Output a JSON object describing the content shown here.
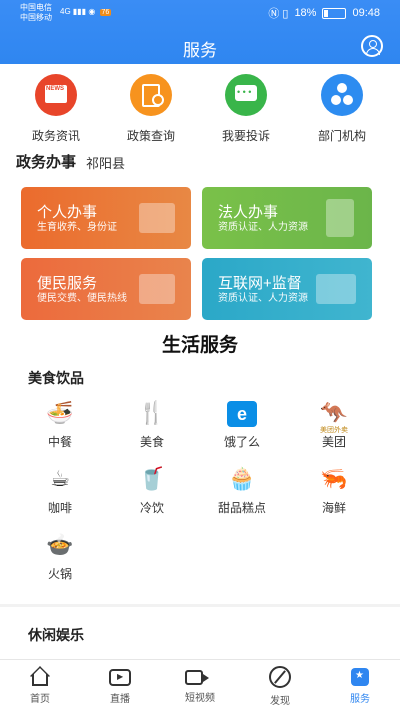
{
  "status_bar": {
    "carrier_1": "中国电信",
    "carrier_2": "中国移动",
    "network": "4G",
    "signal_badge": "76",
    "battery": "18%",
    "time": "09:48"
  },
  "header": {
    "title": "服务"
  },
  "quick_links": [
    {
      "label": "政务资讯",
      "icon": "news-icon",
      "color": "#e8452a"
    },
    {
      "label": "政策查询",
      "icon": "policy-search-icon",
      "color": "#f7931e"
    },
    {
      "label": "我要投诉",
      "icon": "complaint-icon",
      "color": "#39b54a"
    },
    {
      "label": "部门机构",
      "icon": "org-icon",
      "color": "#2d8cf0"
    }
  ],
  "government": {
    "title": "政务办事",
    "county": "祁阳县",
    "cards": [
      {
        "title": "个人办事",
        "subtitle": "生育收养、身份证",
        "icon": "id-card-icon",
        "color": "#eb6b2d"
      },
      {
        "title": "法人办事",
        "subtitle": "资质认证、人力资源",
        "icon": "document-icon",
        "color": "#7ac149"
      },
      {
        "title": "便民服务",
        "subtitle": "便民交费、便民热线",
        "icon": "folder-compass-icon",
        "color": "#ec6a3c"
      },
      {
        "title": "互联网+监督",
        "subtitle": "资质认证、人力资源",
        "icon": "monitor-icon",
        "color": "#2ba8c8"
      }
    ]
  },
  "life": {
    "title": "生活服务",
    "food_category": "美食饮品",
    "food_items": [
      {
        "label": "中餐",
        "icon": "noodle-bowl-icon"
      },
      {
        "label": "美食",
        "icon": "fork-knife-icon"
      },
      {
        "label": "饿了么",
        "icon": "eleme-logo-icon",
        "logo_text": "e"
      },
      {
        "label": "美团",
        "icon": "meituan-kangaroo-icon",
        "logo_text": "美团外卖"
      },
      {
        "label": "咖啡",
        "icon": "coffee-cup-icon"
      },
      {
        "label": "冷饮",
        "icon": "cold-drink-icon"
      },
      {
        "label": "甜品糕点",
        "icon": "cake-icon"
      },
      {
        "label": "海鲜",
        "icon": "shrimp-icon"
      },
      {
        "label": "火锅",
        "icon": "hotpot-icon"
      }
    ],
    "entertainment_category": "休闲娱乐"
  },
  "bottom_nav": [
    {
      "label": "首页",
      "icon": "home-icon",
      "active": false
    },
    {
      "label": "直播",
      "icon": "live-tv-icon",
      "active": false
    },
    {
      "label": "短视频",
      "icon": "video-camera-icon",
      "active": false
    },
    {
      "label": "发现",
      "icon": "discover-icon",
      "active": false
    },
    {
      "label": "服务",
      "icon": "service-icon",
      "active": true
    }
  ],
  "colors": {
    "primary": "#2f86f0",
    "background": "#f2f2f2"
  }
}
